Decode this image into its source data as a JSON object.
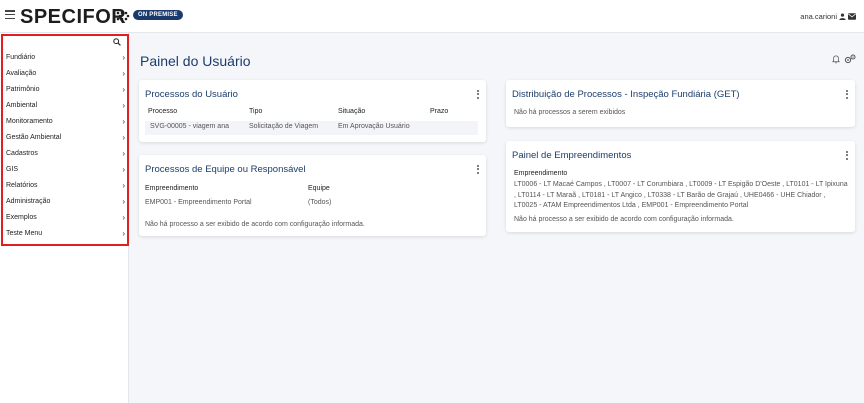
{
  "topbar": {
    "logo": "SPECIFOR",
    "badge": "ON PREMISE",
    "user": "ana.carioni"
  },
  "sidebar": {
    "items": [
      {
        "label": "Fundiário"
      },
      {
        "label": "Avaliação"
      },
      {
        "label": "Patrimônio"
      },
      {
        "label": "Ambiental"
      },
      {
        "label": "Monitoramento"
      },
      {
        "label": "Gestão Ambiental"
      },
      {
        "label": "Cadastros"
      },
      {
        "label": "GIS"
      },
      {
        "label": "Relatórios"
      },
      {
        "label": "Administração"
      },
      {
        "label": "Exemplos"
      },
      {
        "label": "Teste Menu"
      }
    ]
  },
  "main": {
    "title": "Painel do Usuário",
    "processos_usuario": {
      "title": "Processos do Usuário",
      "columns": [
        "Processo",
        "Tipo",
        "Situação",
        "Prazo"
      ],
      "row": [
        "SVG-00005 - viagem ana",
        "Solicitação de Viagem",
        "Em Aprovação Usuário",
        ""
      ]
    },
    "processos_equipe": {
      "title": "Processos de Equipe ou Responsável",
      "empreendimento_label": "Empreendimento",
      "equipe_label": "Equipe",
      "empreendimento_value": "EMP001 - Empreendimento Portal",
      "equipe_value": "(Todos)",
      "message": "Não há processo a ser exibido de acordo com configuração informada."
    },
    "distribuicao": {
      "title": "Distribuição de Processos - Inspeção Fundiária (GET)",
      "message": "Não há processos a serem exibidos"
    },
    "painel_empreendimentos": {
      "title": "Painel de Empreendimentos",
      "label": "Empreendimento",
      "list": "LT0006 - LT Macaé Campos , LT0007 - LT Corumbiara , LT0009 - LT Espigão D'Oeste , LT0101 - LT Ipixuna , LT0114 - LT Maraã , LT0181 - LT Angico , LT0338 - LT Barão de Grajaú , UHE0466 - UHE Chiador , LT0025 - ATAM Empreendimentos Ltda , EMP001 - Empreendimento Portal",
      "message": "Não há processo a ser exibido de acordo com configuração informada."
    }
  }
}
